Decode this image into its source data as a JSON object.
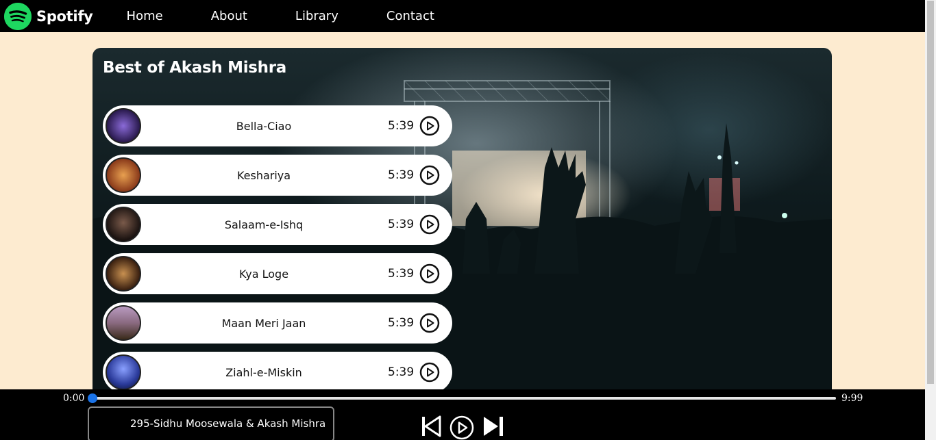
{
  "nav": {
    "brand": "Spotify",
    "links": [
      "Home",
      "About",
      "Library",
      "Contact"
    ]
  },
  "playlist": {
    "title": "Best of Akash Mishra",
    "songs": [
      {
        "name": "Bella-Ciao",
        "duration": "5:39",
        "thumb_color": "#3b2a6e"
      },
      {
        "name": "Keshariya",
        "duration": "5:39",
        "thumb_color": "#b5552a"
      },
      {
        "name": "Salaam-e-Ishq",
        "duration": "5:39",
        "thumb_color": "#3a2a22"
      },
      {
        "name": "Kya Loge",
        "duration": "5:39",
        "thumb_color": "#6b4a2a"
      },
      {
        "name": "Maan Meri Jaan",
        "duration": "5:39",
        "thumb_color": "#8a6a80"
      },
      {
        "name": "Ziahl-e-Miskin",
        "duration": "5:39",
        "thumb_color": "#2a3a9a"
      }
    ]
  },
  "player": {
    "current_time": "0:00",
    "total_time": "9:99",
    "progress": 0.0,
    "now_playing": "295-Sidhu Moosewala & Akash Mishra"
  },
  "colors": {
    "brand_green": "#1ed760",
    "accent_blue": "#1a73e8",
    "page_bg": "#fdebd0"
  }
}
